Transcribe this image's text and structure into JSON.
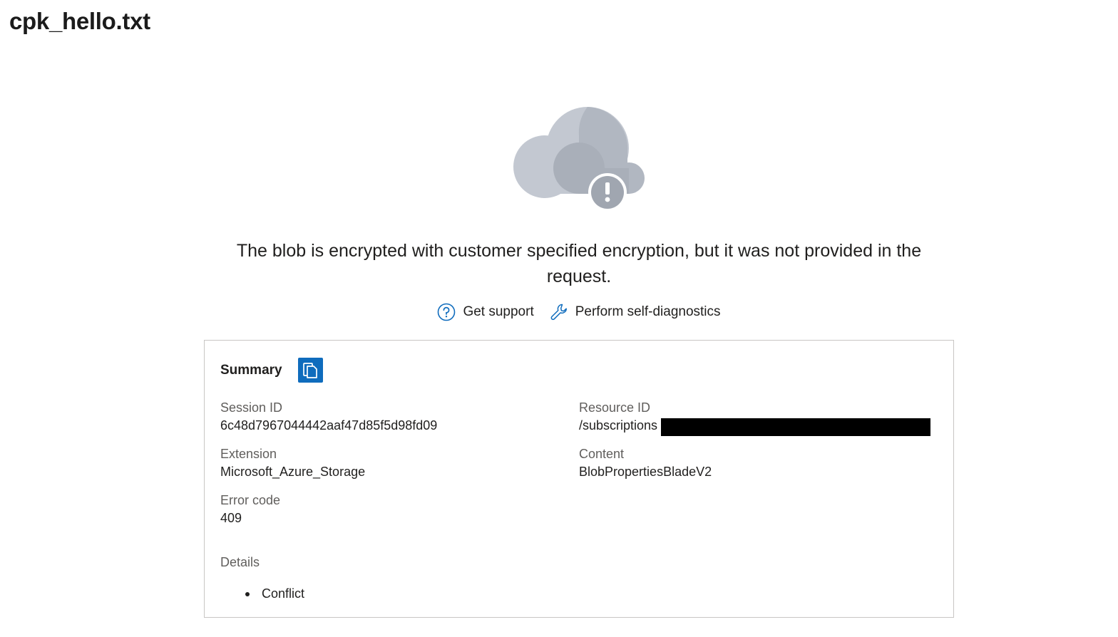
{
  "page": {
    "title": "cpk_hello.txt"
  },
  "error": {
    "message": "The blob is encrypted with customer specified encryption, but it was not provided in the request.",
    "icon": "cloud-error-icon"
  },
  "actions": [
    {
      "label": "Get support",
      "icon": "question-circle-icon"
    },
    {
      "label": "Perform self-diagnostics",
      "icon": "wrench-icon"
    }
  ],
  "summary": {
    "label": "Summary",
    "copy_icon": "copy-icon",
    "fields": {
      "session_id": {
        "label": "Session ID",
        "value": "6c48d7967044442aaf47d85f5d98fd09"
      },
      "resource_id": {
        "label": "Resource ID",
        "value": "/subscriptions"
      },
      "extension": {
        "label": "Extension",
        "value": "Microsoft_Azure_Storage"
      },
      "content": {
        "label": "Content",
        "value": "BlobPropertiesBladeV2"
      },
      "error_code": {
        "label": "Error code",
        "value": "409"
      }
    },
    "details": {
      "label": "Details",
      "items": [
        "Conflict"
      ]
    }
  },
  "colors": {
    "accent": "#0f6cbd",
    "cloud_light": "#c3c8d1",
    "cloud_dark": "#a9afb9",
    "badge": "#a0a6b0",
    "border": "#c8c6c4",
    "label_gray": "#605e5c"
  }
}
